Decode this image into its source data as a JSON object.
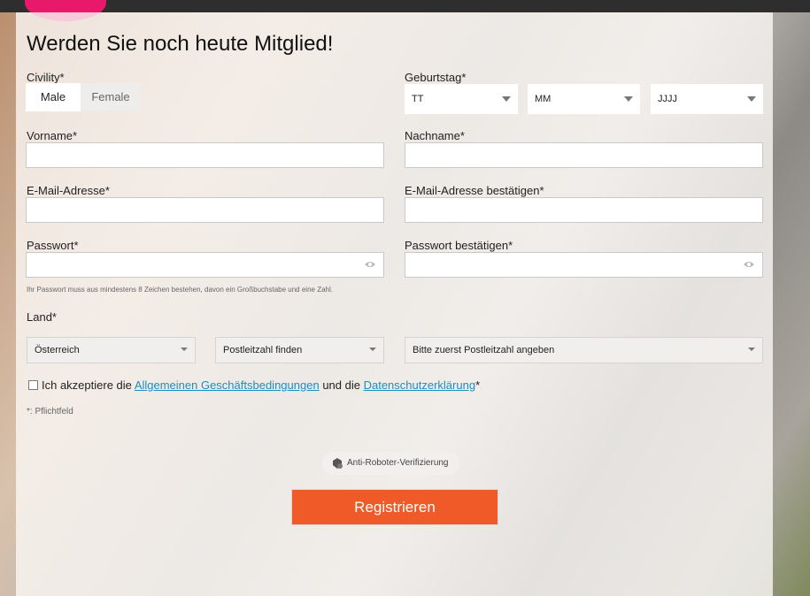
{
  "header": {
    "title": "Werden Sie noch heute Mitglied!"
  },
  "civility": {
    "label": "Civility*",
    "options": [
      "Male",
      "Female"
    ],
    "selected": "Male"
  },
  "birthday": {
    "label": "Geburtstag*",
    "day": "TT",
    "month": "MM",
    "year": "JJJJ"
  },
  "first_name": {
    "label": "Vorname*",
    "value": ""
  },
  "last_name": {
    "label": "Nachname*",
    "value": ""
  },
  "email": {
    "label": "E-Mail-Adresse*",
    "value": ""
  },
  "email_confirm": {
    "label": "E-Mail-Adresse bestätigen*",
    "value": ""
  },
  "password": {
    "label": "Passwort*",
    "value": "",
    "hint": "Ihr Passwort muss aus mindestens 8 Zeichen bestehen, davon ein Großbuchstabe und eine Zahl."
  },
  "password_confirm": {
    "label": "Passwort bestätigen*",
    "value": ""
  },
  "country": {
    "label": "Land*",
    "value": "Österreich"
  },
  "postal_code": {
    "value": "Postleitzahl finden"
  },
  "city": {
    "value": "Bitte zuerst Postleitzahl angeben"
  },
  "consent": {
    "prefix": "Ich akzeptiere die",
    "terms_link": "Allgemeinen Geschäftsbedingungen",
    "middle": "und die",
    "privacy_link": "Datenschutzerklärung",
    "suffix": "*"
  },
  "required_note": "*: Pflichtfeld",
  "captcha": {
    "label": "Anti-Roboter-Verifizierung"
  },
  "submit": {
    "label": "Registrieren"
  },
  "colors": {
    "accent": "#f05a28",
    "link": "#1a8fc1",
    "brand": "#e8186a"
  }
}
